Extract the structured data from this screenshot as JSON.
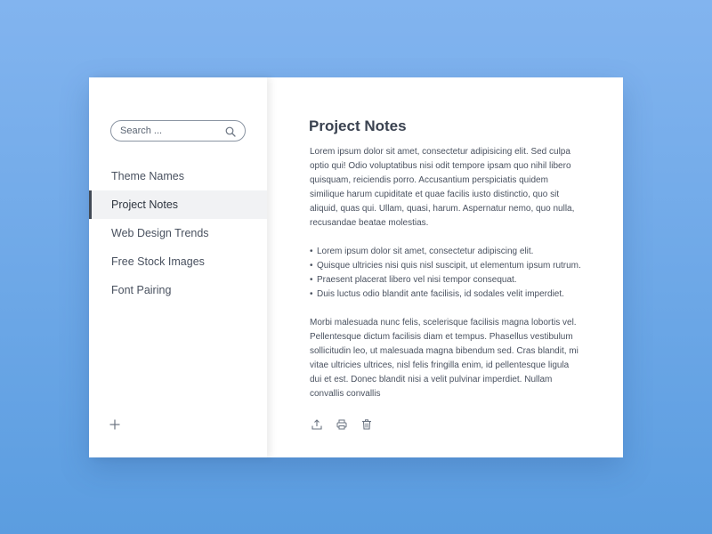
{
  "sidebar": {
    "search": {
      "placeholder": "Search ..."
    },
    "items": [
      {
        "label": "Theme Names",
        "active": false
      },
      {
        "label": "Project Notes",
        "active": true
      },
      {
        "label": "Web Design Trends",
        "active": false
      },
      {
        "label": "Free Stock Images",
        "active": false
      },
      {
        "label": "Font Pairing",
        "active": false
      }
    ],
    "add_icon": "plus-icon"
  },
  "note": {
    "title": "Project Notes",
    "paragraph1": "Lorem ipsum dolor sit amet, consectetur adipisicing elit. Sed culpa optio qui! Odio voluptatibus nisi odit tempore ipsam quo nihil libero quisquam, reiciendis porro. Accusantium perspiciatis quidem similique harum cupiditate et quae facilis iusto distinctio, quo sit aliquid, quas qui. Ullam, quasi, harum. Aspernatur nemo, quo nulla, recusandae beatae molestias.",
    "bullets": [
      "Lorem ipsum dolor sit amet, consectetur adipiscing elit.",
      "Quisque ultricies nisi quis nisl suscipit, ut elementum ipsum rutrum.",
      "Praesent placerat libero vel nisi tempor consequat.",
      "Duis luctus odio blandit ante facilisis, id sodales velit imperdiet."
    ],
    "paragraph2": "Morbi malesuada nunc felis, scelerisque facilisis magna lobortis vel. Pellentesque dictum facilisis diam et tempus. Phasellus vestibulum sollicitudin leo, ut malesuada magna bibendum sed. Cras blandit, mi vitae ultricies ultrices, nisl felis fringilla enim, id pellentesque ligula dui et est. Donec blandit nisi a velit pulvinar imperdiet. Nullam convallis convallis"
  },
  "toolbar": {
    "icons": [
      "upload-icon",
      "print-icon",
      "trash-icon"
    ]
  },
  "colors": {
    "background": "#6ea8ea",
    "active_indicator": "#424a56",
    "text": "#4a5260"
  }
}
